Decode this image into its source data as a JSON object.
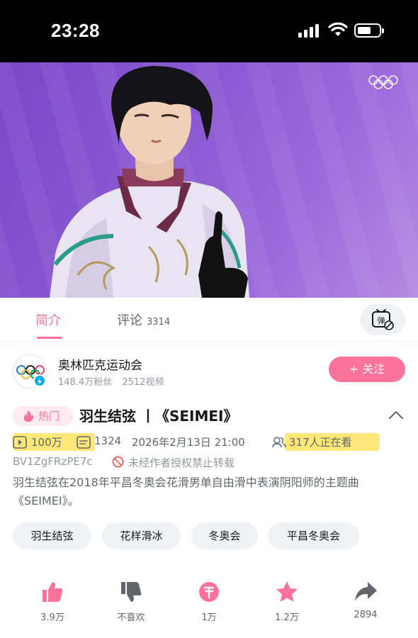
{
  "status_bar": {
    "time": "23:28"
  },
  "video": {
    "player_logo": "olympic-rings"
  },
  "tabs": {
    "intro_label": "简介",
    "comments_label": "评论",
    "comments_count": "3314",
    "danmaku_icon": "danmaku-toggle-icon"
  },
  "uploader": {
    "name": "奥林匹克运动会",
    "followers": "148.4万粉丝",
    "videos": "2512视频",
    "follow_label": "+ 关注"
  },
  "video_info": {
    "hot_label": "热门",
    "title": "羽生结弦 丨《SEIMEI》",
    "views": "100万",
    "danmaku_count": "1324",
    "publish_time": "2026年2月13日 21:00",
    "watching_now": "317人正在看",
    "bvid": "BV1ZgFRzPE7c",
    "copyright_notice": "未经作者授权禁止转载",
    "description": "羽生结弦在2018年平昌冬奥会花滑男单自由滑中表演阴阳师的主题曲《SEIMEI》。"
  },
  "tags": [
    "羽生结弦",
    "花样滑冰",
    "冬奥会",
    "平昌冬奥会"
  ],
  "actions": {
    "like": "3.9万",
    "dislike": "不喜欢",
    "coin": "1万",
    "favorite": "1.2万",
    "share": "2894"
  },
  "colors": {
    "accent": "#fb7299",
    "highlight": "#fde778",
    "verified": "#00aeec"
  }
}
